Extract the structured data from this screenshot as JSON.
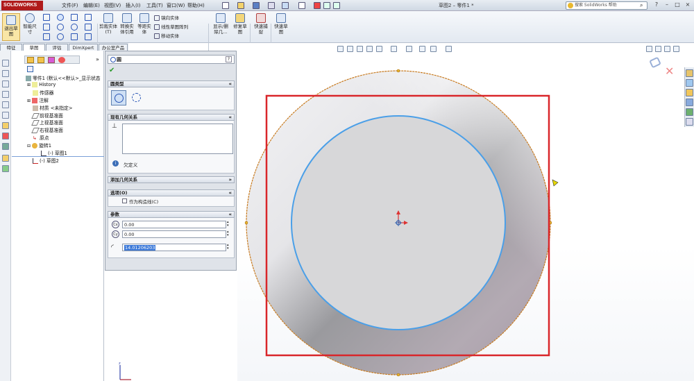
{
  "app": {
    "logo": "SOLIDWORKS",
    "doc_title": "草图2 – 零件1 *"
  },
  "menu": [
    "文件(F)",
    "编辑(E)",
    "视图(V)",
    "插入(I)",
    "工具(T)",
    "窗口(W)",
    "帮助(H)"
  ],
  "search": {
    "placeholder": "搜索 SolidWorks 帮助"
  },
  "window_buttons": [
    "?",
    "–",
    "□",
    "×"
  ],
  "ribbon": {
    "exit_sketch": "退出草图",
    "smart_dim": "智能尺寸",
    "trim": "剪裁实体(T)",
    "convert": "转换实体引用",
    "offset": "等距实体",
    "mirror": "镜向实体",
    "linear_pattern": "线性草图阵列",
    "move": "移动实体",
    "show_delete": "显示/删除几...",
    "repair": "修复草图",
    "quick_snap": "快速捕捉",
    "quick_sketch": "快速草图"
  },
  "tabs": [
    "特征",
    "草图",
    "评估",
    "DimXpert",
    "办公室产品"
  ],
  "tree": {
    "root": "零件1 (默认<<默认>_显示状态",
    "items": [
      "History",
      "传感器",
      "注解",
      "材质 <未指定>",
      "前视基准面",
      "上视基准面",
      "右视基准面",
      "原点",
      "旋转1",
      "(-) 草图1",
      "(-) 草图2"
    ]
  },
  "pm": {
    "title": "圆",
    "help": "?",
    "circle_type": "圆类型",
    "existing_relations": "现有几何关系",
    "under_defined": "欠定义",
    "add_relations": "添加几何关系",
    "options": "选项(O)",
    "construction": "作为构造线(C)",
    "params": "参数",
    "cx": "0.00",
    "cy": "0.00",
    "radius": "14.01206203"
  },
  "colors": {
    "red_frame": "#d9262a",
    "circle_blue": "#4a9fe8",
    "circle_orange": "#c87a1e",
    "solid_gray": "#b9b9bd"
  }
}
